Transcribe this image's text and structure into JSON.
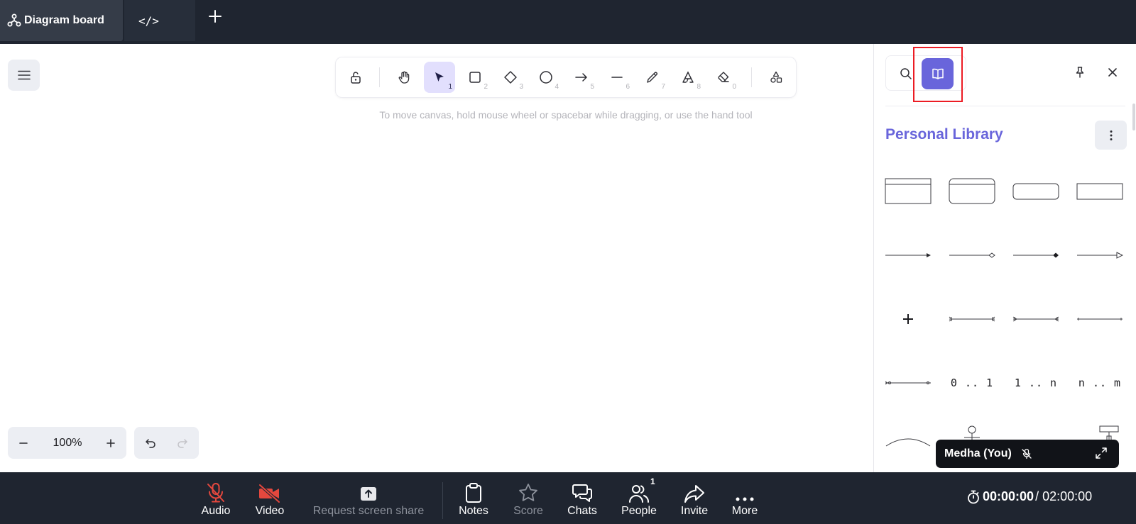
{
  "tabs": [
    {
      "label": "Diagram board",
      "active": true
    },
    {
      "label": "</>",
      "active": false
    }
  ],
  "toolbar": {
    "tools": [
      {
        "name": "lock",
        "shortcut": ""
      },
      {
        "name": "hand",
        "shortcut": ""
      },
      {
        "name": "selection",
        "shortcut": "1",
        "selected": true
      },
      {
        "name": "rectangle",
        "shortcut": "2"
      },
      {
        "name": "diamond",
        "shortcut": "3"
      },
      {
        "name": "ellipse",
        "shortcut": "4"
      },
      {
        "name": "arrow",
        "shortcut": "5"
      },
      {
        "name": "line",
        "shortcut": "6"
      },
      {
        "name": "draw",
        "shortcut": "7"
      },
      {
        "name": "text",
        "shortcut": "8"
      },
      {
        "name": "eraser",
        "shortcut": "0"
      },
      {
        "name": "shapes",
        "shortcut": ""
      }
    ],
    "hint": "To move canvas, hold mouse wheel or spacebar while dragging, or use the hand tool"
  },
  "zoom": {
    "level": "100%"
  },
  "library": {
    "title": "Personal Library",
    "text_items": [
      "0 .. 1",
      "1 .. n",
      "n .. m"
    ]
  },
  "participant": {
    "name": "Medha (You)"
  },
  "controls": [
    {
      "label": "Audio",
      "state": "muted"
    },
    {
      "label": "Video",
      "state": "off"
    },
    {
      "label": "Request screen share",
      "state": "disabled"
    },
    {
      "label": "Notes"
    },
    {
      "label": "Score",
      "state": "disabled"
    },
    {
      "label": "Chats"
    },
    {
      "label": "People"
    },
    {
      "label": "Invite"
    },
    {
      "label": "More"
    }
  ],
  "people_count": "1",
  "timer": {
    "elapsed": "00:00:00",
    "total": "/ 02:00:00"
  },
  "colors": {
    "topbar": "#1f2530",
    "accent": "#6965db",
    "selected_tool": "#e2dffd",
    "muted_red": "#e5483e",
    "highlight_box": "#ec1c24"
  }
}
